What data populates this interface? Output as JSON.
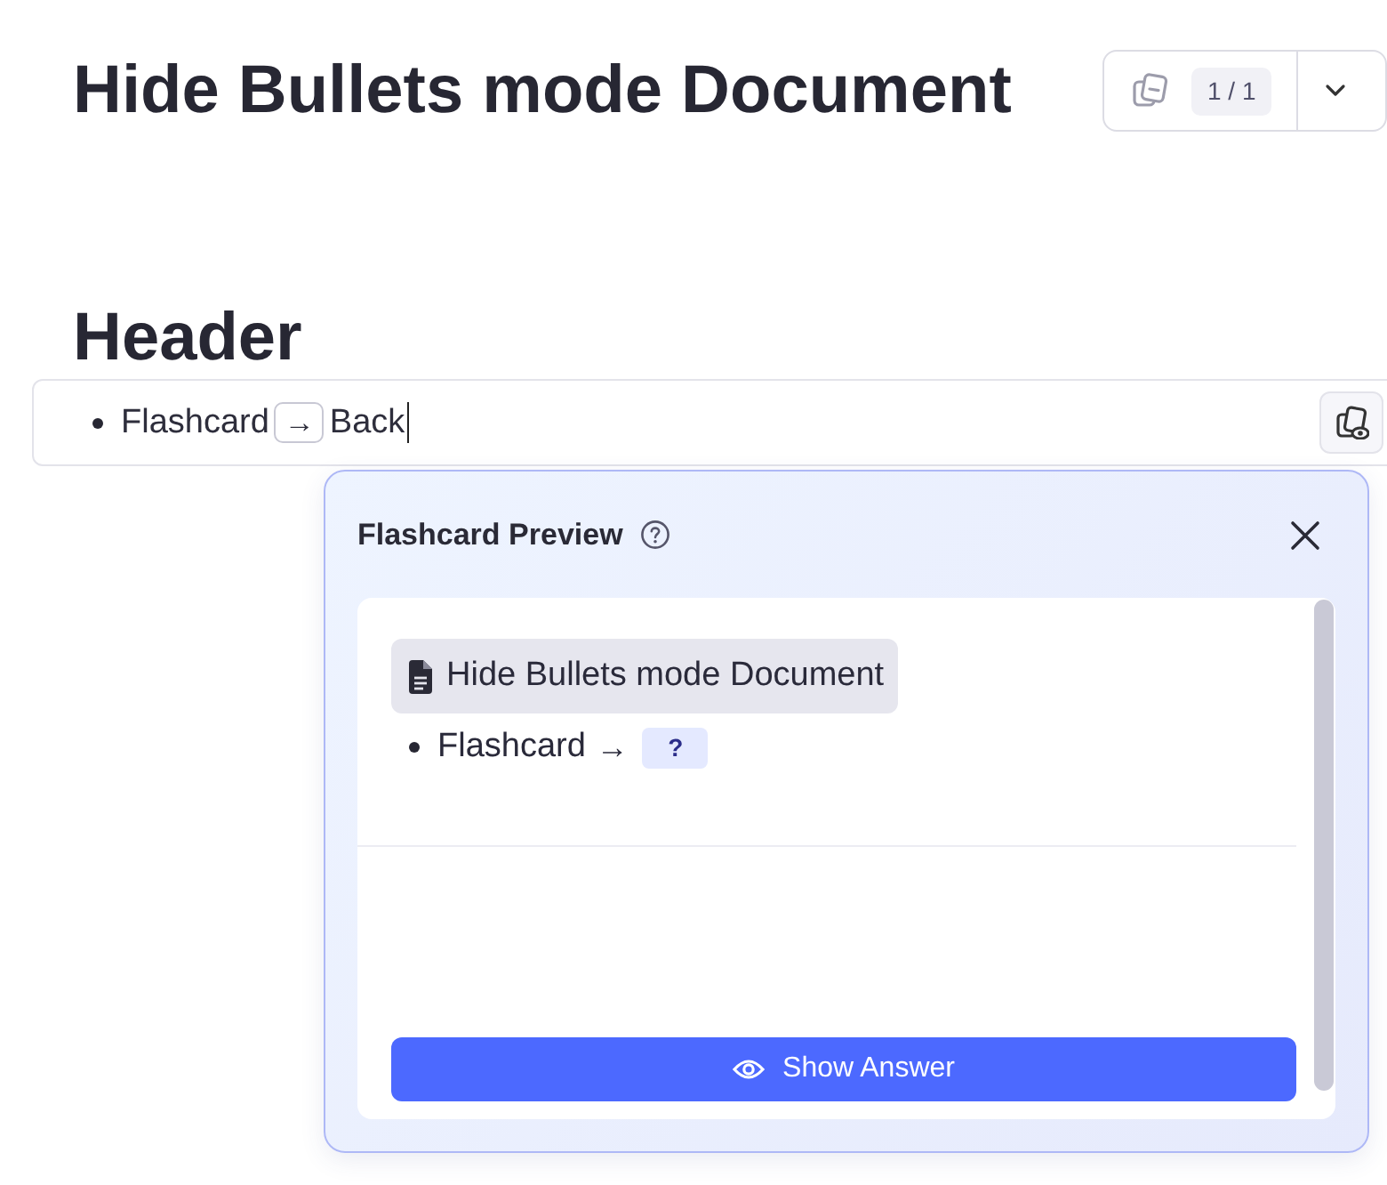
{
  "document": {
    "title": "Hide Bullets mode Document"
  },
  "toolbar": {
    "counter": "1 / 1"
  },
  "section": {
    "heading": "Header"
  },
  "bullet": {
    "front": "Flashcard",
    "separator": "→",
    "back": "Back"
  },
  "preview": {
    "title": "Flashcard Preview",
    "source": "Hide Bullets mode Document",
    "front": "Flashcard",
    "separator": "→",
    "answer_mask": "?",
    "button": "Show Answer"
  }
}
